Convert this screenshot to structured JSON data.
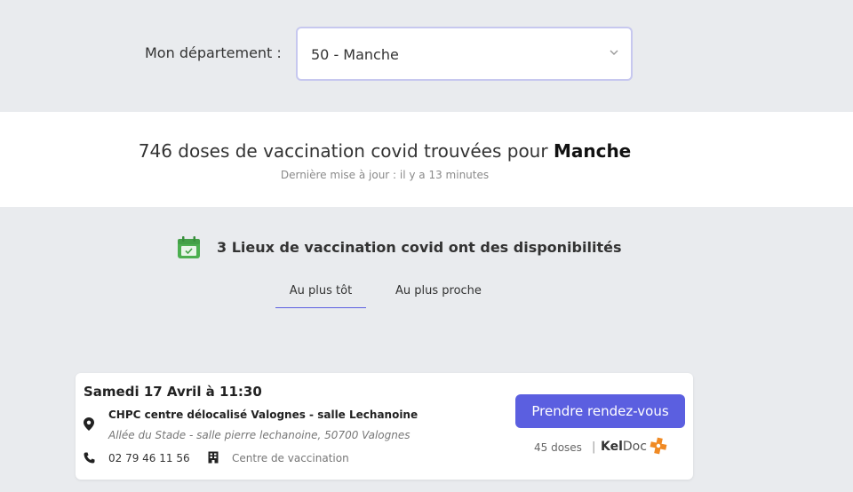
{
  "department": {
    "label": "Mon département :",
    "selected": "50 - Manche"
  },
  "banner": {
    "title_prefix": "746 doses de vaccination covid trouvées pour",
    "title_place": "Manche",
    "updated": "Dernière mise à jour : il y a 13 minutes"
  },
  "places": {
    "text": "3 Lieux de vaccination covid ont des disponibilités",
    "icon": "calendar-check-icon",
    "icon_color": "#4caf50"
  },
  "tabs": [
    {
      "label": "Au plus tôt",
      "active": true
    },
    {
      "label": "Au plus proche",
      "active": false
    }
  ],
  "card": {
    "date": "Samedi 17 Avril à 11:30",
    "name": "CHPC centre délocalisé Valognes - salle Lechanoine",
    "address": "Allée du Stade - salle pierre lechanoine, 50700 Valognes",
    "phone": "02 79 46 11 56",
    "type": "Centre de vaccination",
    "button_label": "Prendre rendez-vous",
    "doses": "45 doses",
    "platform_a": "Kel",
    "platform_b": "Doc"
  },
  "colors": {
    "accent": "#5b5fe0",
    "background": "#e9ebee",
    "keldoc_logo": "#f08a24"
  }
}
